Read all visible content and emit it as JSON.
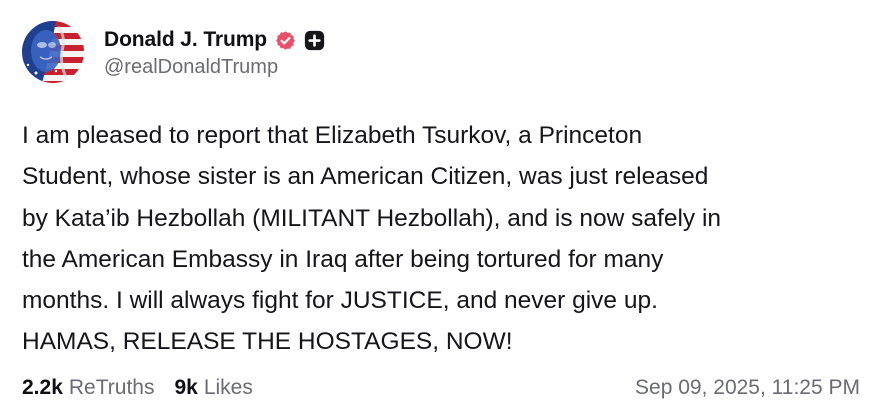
{
  "author": {
    "display_name": "Donald J. Trump",
    "handle": "@realDonaldTrump",
    "verified_icon": "verified-badge-icon",
    "plus_icon": "plus-badge-icon",
    "accent_color": "#e5526b"
  },
  "post": {
    "lines": [
      "I am pleased to report that Elizabeth Tsurkov, a Princeton",
      "Student, whose sister is an American Citizen, was just released",
      "by Kata’ib Hezbollah (MILITANT Hezbollah), and is now safely in",
      "the American Embassy in Iraq after being tortured for many",
      "months. I will always fight for JUSTICE, and never give up.",
      "HAMAS, RELEASE THE HOSTAGES, NOW!"
    ]
  },
  "stats": {
    "retruths_count": "2.2k",
    "retruths_label": "ReTruths",
    "likes_count": "9k",
    "likes_label": "Likes"
  },
  "timestamp": "Sep 09, 2025, 11:25 PM"
}
